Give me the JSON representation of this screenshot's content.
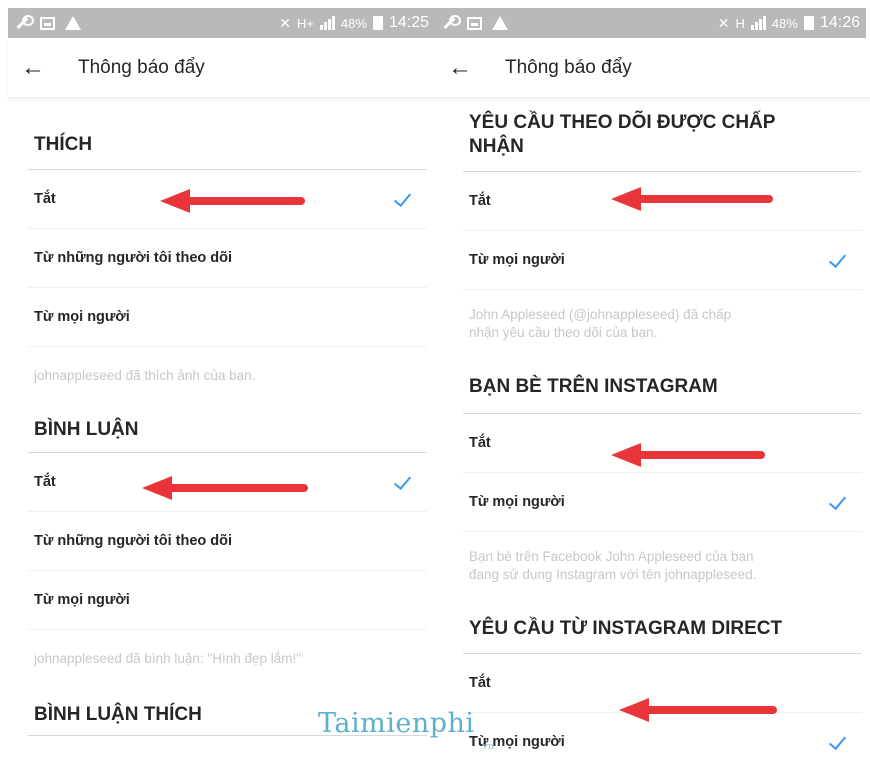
{
  "left_screen": {
    "statusbar": {
      "network": "H+",
      "battery": "48%",
      "time": "14:25"
    },
    "toolbar": {
      "title": "Thông báo đẩy"
    },
    "sections": [
      {
        "header": "THÍCH",
        "options": [
          {
            "label": "Tắt",
            "selected": true
          },
          {
            "label": "Từ những người tôi theo dõi",
            "selected": false
          },
          {
            "label": "Từ mọi người",
            "selected": false
          }
        ],
        "example": "johnappleseed đã thích ảnh của bạn."
      },
      {
        "header": "BÌNH LUẬN",
        "options": [
          {
            "label": "Tắt",
            "selected": true
          },
          {
            "label": "Từ những người tôi theo dõi",
            "selected": false
          },
          {
            "label": "Từ mọi người",
            "selected": false
          }
        ],
        "example": "johnappleseed đã bình luận: \"Hình đẹp lắm!\""
      },
      {
        "header": "BÌNH LUẬN THÍCH"
      }
    ]
  },
  "right_screen": {
    "statusbar": {
      "network": "H",
      "battery": "48%",
      "time": "14:26"
    },
    "toolbar": {
      "title": "Thông báo đẩy"
    },
    "sections": [
      {
        "header_line1": "YÊU CẦU THEO DÕI ĐƯỢC CHẤP",
        "header_line2": "NHẬN",
        "options": [
          {
            "label": "Tắt",
            "selected": false
          },
          {
            "label": "Từ mọi người",
            "selected": true
          }
        ],
        "example_line1": "John Appleseed (@johnappleseed) đã chấp",
        "example_line2": "nhận yêu cầu theo dõi của bạn."
      },
      {
        "header": "BẠN BÈ TRÊN INSTAGRAM",
        "options": [
          {
            "label": "Tắt",
            "selected": false
          },
          {
            "label": "Từ mọi người",
            "selected": true
          }
        ],
        "example_line1": "Bạn bè trên Facebook John Appleseed của bạn",
        "example_line2": "đang sử dụng Instagram với tên johnappleseed."
      },
      {
        "header": "YÊU CẦU TỪ INSTAGRAM DIRECT",
        "options": [
          {
            "label": "Tắt",
            "selected": false
          },
          {
            "label": "Từ mọi người",
            "selected": true
          }
        ]
      }
    ]
  },
  "watermark": {
    "brand": "Taimienphi",
    "suffix": ".vn"
  },
  "colors": {
    "check": "#3897f0",
    "arrow": "#e8353a",
    "statusbar": "#b9b9b9",
    "watermark": "#4aa8c6"
  },
  "icons": [
    "wrench-icon",
    "image-icon",
    "warning-icon",
    "mute-icon",
    "signal-icon",
    "battery-icon",
    "back-arrow-icon",
    "checkmark-icon"
  ]
}
